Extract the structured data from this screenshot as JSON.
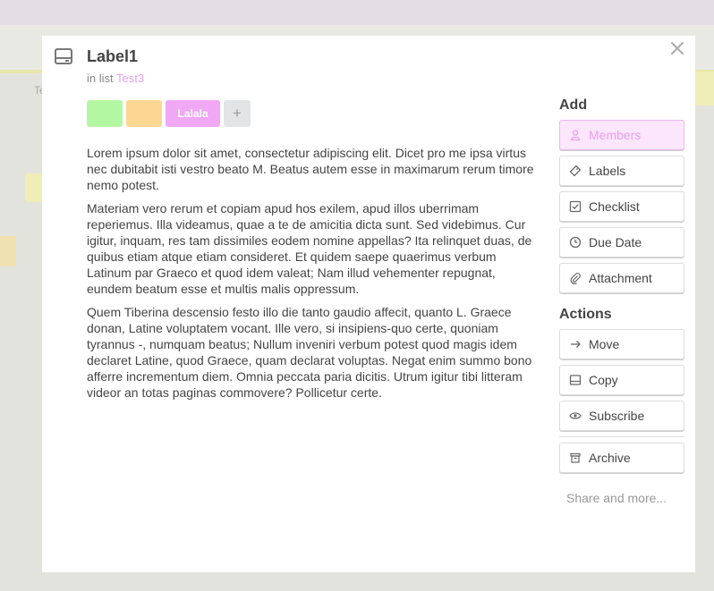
{
  "colors": {
    "accent": "#e99ff0",
    "label_green": "#b4f7a3",
    "label_orange": "#fdd694",
    "label_pink": "#f0a7f4"
  },
  "card": {
    "title": "Label1",
    "list_prefix": "in list",
    "list_name": "Test3",
    "labels": [
      {
        "name": "",
        "color": "green"
      },
      {
        "name": "",
        "color": "orange"
      },
      {
        "name": "Lalala",
        "color": "pink"
      }
    ],
    "add_label_glyph": "+",
    "description": [
      "Lorem ipsum dolor sit amet, consectetur adipiscing elit. Dicet pro me ipsa virtus nec dubitabit isti vestro beato M. Beatus autem esse in maximarum rerum timore nemo potest.",
      "Materiam vero rerum et copiam apud hos exilem, apud illos uberrimam reperiemus. Illa videamus, quae a te de amicitia dicta sunt. Sed videbimus. Cur igitur, inquam, res tam dissimiles eodem nomine appellas? Ita relinquet duas, de quibus etiam atque etiam consideret. Et quidem saepe quaerimus verbum Latinum par Graeco et quod idem valeat; Nam illud vehementer repugnat, eundem beatum esse et multis malis oppressum.",
      "Quem Tiberina descensio festo illo die tanto gaudio affecit, quanto L. Graece donan, Latine voluptatem vocant. Ille vero, si insipiens-quo certe, quoniam tyrannus -, numquam beatus; Nullum inveniri verbum potest quod magis idem declaret Latine, quod Graece, quam declarat voluptas. Negat enim summo bono afferre incrementum diem. Omnia peccata paria dicitis. Utrum igitur tibi litteram videor an totas paginas commovere? Pollicetur certe."
    ]
  },
  "sidebar": {
    "add_heading": "Add",
    "add_items": [
      {
        "label": "Members",
        "icon": "person-icon",
        "active": true
      },
      {
        "label": "Labels",
        "icon": "tag-icon"
      },
      {
        "label": "Checklist",
        "icon": "checkbox-icon"
      },
      {
        "label": "Due Date",
        "icon": "clock-icon"
      },
      {
        "label": "Attachment",
        "icon": "paperclip-icon"
      }
    ],
    "actions_heading": "Actions",
    "action_items": [
      {
        "label": "Move",
        "icon": "arrow-right-icon"
      },
      {
        "label": "Copy",
        "icon": "card-icon"
      },
      {
        "label": "Subscribe",
        "icon": "eye-icon"
      },
      {
        "label": "Archive",
        "icon": "archive-icon"
      }
    ],
    "share_label": "Share and more..."
  },
  "background": {
    "tab_text": "Te"
  }
}
